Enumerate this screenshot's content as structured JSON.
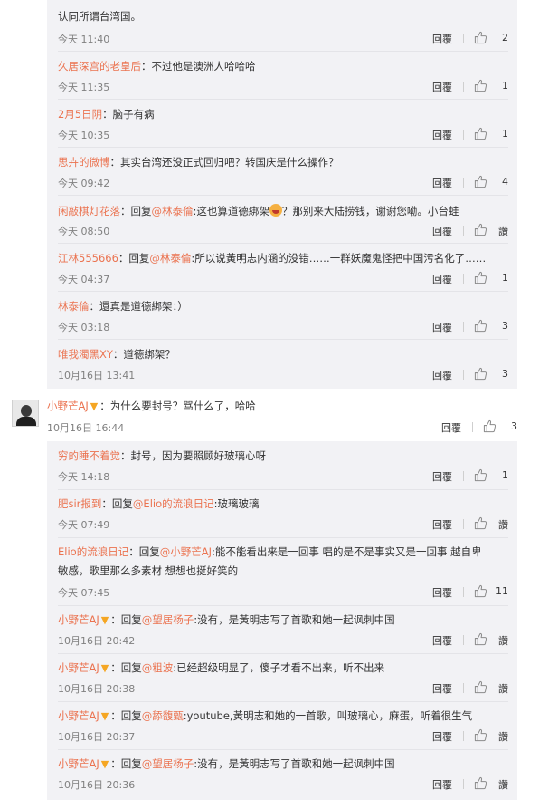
{
  "reply_label": "回覆",
  "top_partial": {
    "line1": "认同所谓台湾国。",
    "time": "今天 11:40",
    "likes": "2"
  },
  "replies_a": [
    {
      "nick": "久居深宫的老皇后",
      "parts": [
        {
          "t": "：不过他是澳洲人哈哈哈"
        }
      ],
      "time": "今天 11:35",
      "likes": "1"
    },
    {
      "nick": "2月5日阴",
      "parts": [
        {
          "t": "：脑子有病"
        }
      ],
      "time": "今天 10:35",
      "likes": "1"
    },
    {
      "nick": "思卉的微博",
      "parts": [
        {
          "t": "：其实台湾还没正式回归吧？转国庆是什么操作？"
        }
      ],
      "time": "今天 09:42",
      "likes": "4"
    },
    {
      "nick": "闲敲棋灯花落",
      "parts": [
        {
          "t": "：回复"
        },
        {
          "at": "@林泰倫"
        },
        {
          "t": ":这也算道德綁架"
        },
        {
          "emoji": "laugh-emoji"
        },
        {
          "t": "？那别来大陆捞钱，谢谢您嘞。小台蛙"
        }
      ],
      "time": "今天 08:50",
      "likes": "讚"
    },
    {
      "nick": "江林555666",
      "parts": [
        {
          "t": "：回复"
        },
        {
          "at": "@林泰倫"
        },
        {
          "t": ":所以说黃明志内涵的没错……一群妖魔鬼怪把中国污名化了……"
        }
      ],
      "time": "今天 04:37",
      "likes": "1"
    },
    {
      "nick": "林泰倫",
      "parts": [
        {
          "t": "：還真是道德綁架：）"
        }
      ],
      "time": "今天 03:18",
      "likes": "3"
    },
    {
      "nick": "唯我濁黑XY",
      "parts": [
        {
          "t": "：道德綁架？"
        }
      ],
      "time": "10月16日 13:41",
      "likes": "3"
    }
  ],
  "main_comment": {
    "nick": "小野芒AJ",
    "text": "：为什么要封号？骂什么了，哈哈",
    "time": "10月16日 16:44",
    "likes": "3",
    "avatar": "user-avatar"
  },
  "replies_b": [
    {
      "nick": "穷的睡不着觉",
      "vip": false,
      "parts": [
        {
          "t": "：封号，因为要照顾好玻璃心呀"
        }
      ],
      "time": "今天 14:18",
      "likes": "1"
    },
    {
      "nick": "肥sir报到",
      "vip": false,
      "parts": [
        {
          "t": "：回复"
        },
        {
          "at": "@Elio的流浪日记"
        },
        {
          "t": ":玻璃玻璃"
        }
      ],
      "time": "今天 07:49",
      "likes": "讚"
    },
    {
      "nick": "Elio的流浪日记",
      "vip": false,
      "parts": [
        {
          "t": "：回复"
        },
        {
          "at": "@小野芒AJ"
        },
        {
          "t": ":能不能看出来是一回事  唱的是不是事实又是一回事 越自卑"
        }
      ],
      "line2": "敏感，歌里那么多素材 想想也挺好笑的",
      "time": "今天 07:45",
      "likes": "11"
    },
    {
      "nick": "小野芒AJ",
      "vip": true,
      "parts": [
        {
          "t": "：回复"
        },
        {
          "at": "@望居杨子"
        },
        {
          "t": ":没有，是黃明志写了首歌和她一起讽刺中国"
        }
      ],
      "time": "10月16日 20:42",
      "likes": "讚"
    },
    {
      "nick": "小野芒AJ",
      "vip": true,
      "parts": [
        {
          "t": "：回复"
        },
        {
          "at": "@粗波"
        },
        {
          "t": ":已经超级明显了，傻子才看不出来，听不出来"
        }
      ],
      "time": "10月16日 20:38",
      "likes": "讚"
    },
    {
      "nick": "小野芒AJ",
      "vip": true,
      "parts": [
        {
          "t": "：回复"
        },
        {
          "at": "@舔馥甄"
        },
        {
          "t": ":youtube,黃明志和她的一首歌，叫玻璃心，麻蛋，听着很生气"
        }
      ],
      "time": "10月16日 20:37",
      "likes": "讚"
    },
    {
      "nick": "小野芒AJ",
      "vip": true,
      "parts": [
        {
          "t": "：回复"
        },
        {
          "at": "@望居杨子"
        },
        {
          "t": ":没有，是黃明志写了首歌和她一起讽刺中国"
        }
      ],
      "time": "10月16日 20:36",
      "likes": "讚"
    }
  ]
}
